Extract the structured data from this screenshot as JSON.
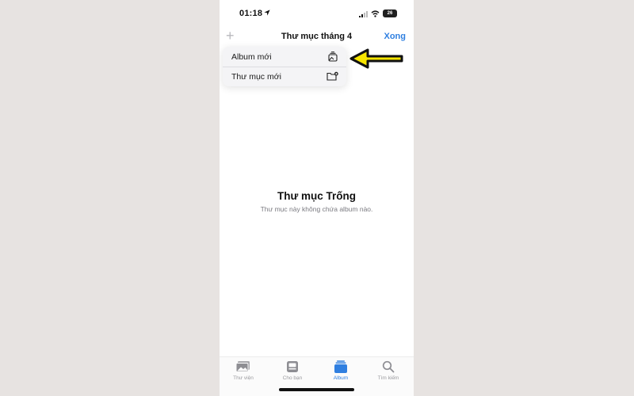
{
  "status": {
    "time": "01:18",
    "battery": "26"
  },
  "nav": {
    "plus": "+",
    "title": "Thư mục tháng 4",
    "done": "Xong"
  },
  "menu": {
    "items": [
      {
        "label": "Album mới",
        "icon": "album-stack-icon"
      },
      {
        "label": "Thư mục mới",
        "icon": "folder-badge-icon"
      }
    ]
  },
  "empty": {
    "title": "Thư mục Trống",
    "subtitle": "Thư mục này không chứa album nào."
  },
  "tabs": [
    {
      "label": "Thư viện",
      "icon": "photo-library-icon",
      "active": false
    },
    {
      "label": "Cho bạn",
      "icon": "for-you-icon",
      "active": false
    },
    {
      "label": "Album",
      "icon": "albums-icon",
      "active": true
    },
    {
      "label": "Tìm kiếm",
      "icon": "search-icon",
      "active": false
    }
  ],
  "colors": {
    "accent": "#2f7fe0",
    "arrow": "#f7e500",
    "background": "#e7e3e1"
  }
}
